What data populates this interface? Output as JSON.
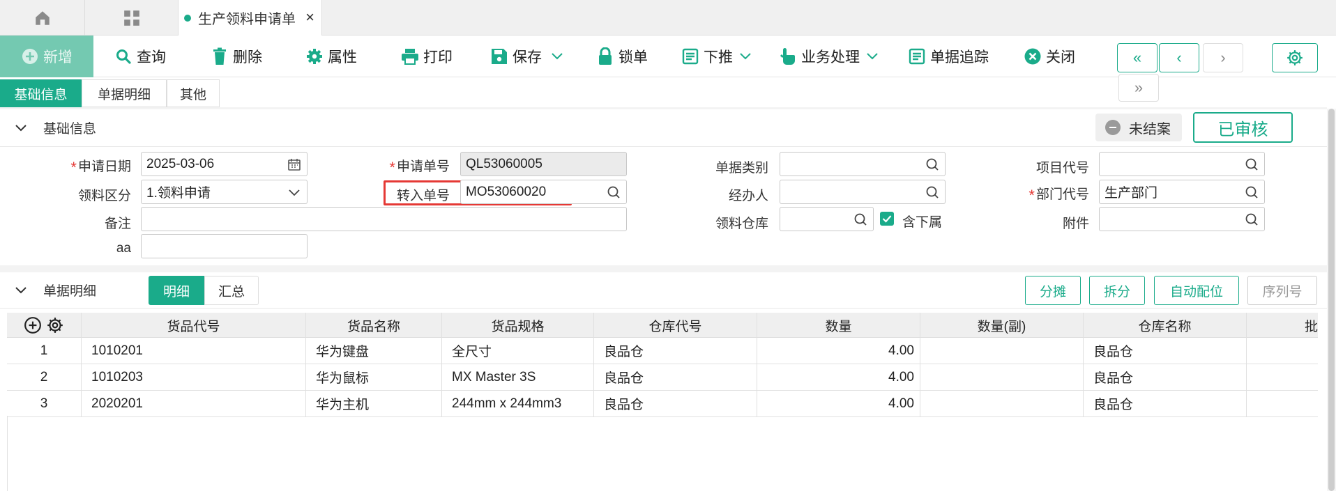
{
  "top_tabs": {
    "home_icon": "home-icon",
    "apps_icon": "grid-icon",
    "document_tab_label": "生产领料申请单",
    "close_symbol": "×"
  },
  "toolbar": {
    "new": "新增",
    "query": "查询",
    "delete": "删除",
    "properties": "属性",
    "print": "打印",
    "save": "保存",
    "lock": "锁单",
    "push_down": "下推",
    "business": "业务处理",
    "trace": "单据追踪",
    "close": "关闭",
    "nav_first": "«",
    "nav_prev": "‹",
    "nav_next": "›",
    "nav_last": "»"
  },
  "tabs": [
    "基础信息",
    "单据明细",
    "其他"
  ],
  "basic_section": {
    "title": "基础信息",
    "status_open": "未结案",
    "status_approved": "已审核"
  },
  "form": {
    "apply_date_label": "申请日期",
    "apply_date_value": "2025-03-06",
    "apply_no_label": "申请单号",
    "apply_no_value": "QL53060005",
    "doc_type_label": "单据类别",
    "doc_type_value": "",
    "project_code_label": "项目代号",
    "project_code_value": "",
    "pick_type_label": "领料区分",
    "pick_type_value": "1.领料申请",
    "transfer_no_label": "转入单号",
    "transfer_no_value": "MO53060020",
    "handler_label": "经办人",
    "handler_value": "",
    "dept_code_label": "部门代号",
    "dept_code_value": "生产部门",
    "remark_label": "备注",
    "remark_value": "",
    "warehouse_label": "领料仓库",
    "warehouse_value": "",
    "include_sub_label": "含下属",
    "include_sub_checked": true,
    "attachment_label": "附件",
    "attachment_value": "",
    "aa_label": "aa",
    "aa_value": ""
  },
  "detail_section": {
    "title": "单据明细",
    "toggle_detail": "明细",
    "toggle_summary": "汇总",
    "btn_share": "分摊",
    "btn_split": "拆分",
    "btn_auto_slot": "自动配位",
    "btn_serial": "序列号"
  },
  "table": {
    "columns": [
      "货品代号",
      "货品名称",
      "货品规格",
      "仓库代号",
      "数量",
      "数量(副)",
      "仓库名称",
      "批"
    ],
    "rows": [
      {
        "no": "1",
        "code": "1010201",
        "name": "华为键盘",
        "spec": "全尺寸",
        "wh_code": "良品仓",
        "qty": "4.00",
        "qty2": "",
        "wh_name": "良品仓"
      },
      {
        "no": "2",
        "code": "1010203",
        "name": "华为鼠标",
        "spec": "MX Master 3S",
        "wh_code": "良品仓",
        "qty": "4.00",
        "qty2": "",
        "wh_name": "良品仓"
      },
      {
        "no": "3",
        "code": "2020201",
        "name": "华为主机",
        "spec": "244mm x 244mm3",
        "wh_code": "良品仓",
        "qty": "4.00",
        "qty2": "",
        "wh_name": "良品仓"
      }
    ]
  },
  "colors": {
    "accent": "#1aab8a",
    "highlight_box": "#e53935",
    "required": "#e53935"
  }
}
